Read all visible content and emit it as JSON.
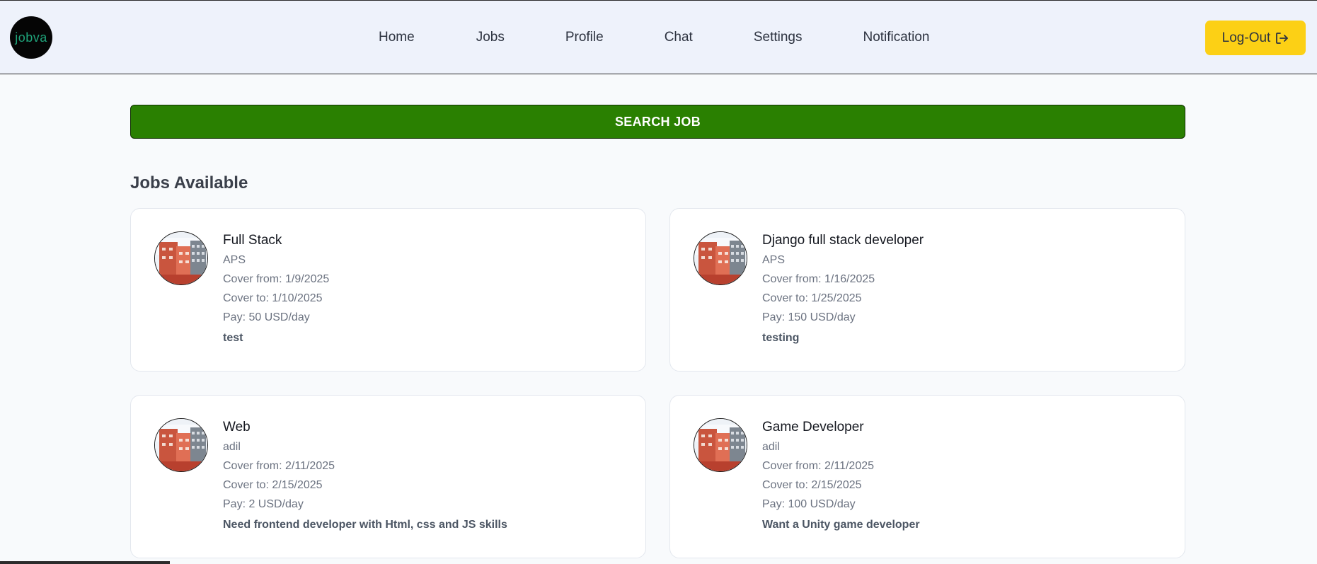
{
  "app": {
    "logo_text": "jobva"
  },
  "nav": {
    "items": [
      {
        "label": "Home",
        "name": "nav-home"
      },
      {
        "label": "Jobs",
        "name": "nav-jobs"
      },
      {
        "label": "Profile",
        "name": "nav-profile"
      },
      {
        "label": "Chat",
        "name": "nav-chat"
      },
      {
        "label": "Settings",
        "name": "nav-settings"
      },
      {
        "label": "Notification",
        "name": "nav-notification"
      }
    ],
    "logout_label": "Log-Out"
  },
  "search": {
    "label": "SEARCH JOB"
  },
  "section": {
    "title": "Jobs Available"
  },
  "jobs": [
    {
      "title": "Full Stack",
      "company": "APS",
      "cover_from": "Cover from: 1/9/2025",
      "cover_to": "Cover to: 1/10/2025",
      "pay": "Pay: 50 USD/day",
      "description": "test"
    },
    {
      "title": "Django full stack developer",
      "company": "APS",
      "cover_from": "Cover from: 1/16/2025",
      "cover_to": "Cover to: 1/25/2025",
      "pay": "Pay: 150 USD/day",
      "description": "testing"
    },
    {
      "title": "Web",
      "company": "adil",
      "cover_from": "Cover from: 2/11/2025",
      "cover_to": "Cover to: 2/15/2025",
      "pay": "Pay: 2 USD/day",
      "description": "Need frontend developer with Html, css and JS skills"
    },
    {
      "title": "Game Developer",
      "company": "adil",
      "cover_from": "Cover from: 2/11/2025",
      "cover_to": "Cover to: 2/15/2025",
      "pay": "Pay: 100 USD/day",
      "description": "Want a Unity game developer"
    }
  ],
  "colors": {
    "navbar_bg": "#eef2fb",
    "logout_bg": "#fcd015",
    "search_bg": "#2a8001",
    "logo_text": "#1fa37a"
  },
  "icons": {
    "logout": "logout-arrow-icon",
    "company_image": "building-photo-icon"
  }
}
